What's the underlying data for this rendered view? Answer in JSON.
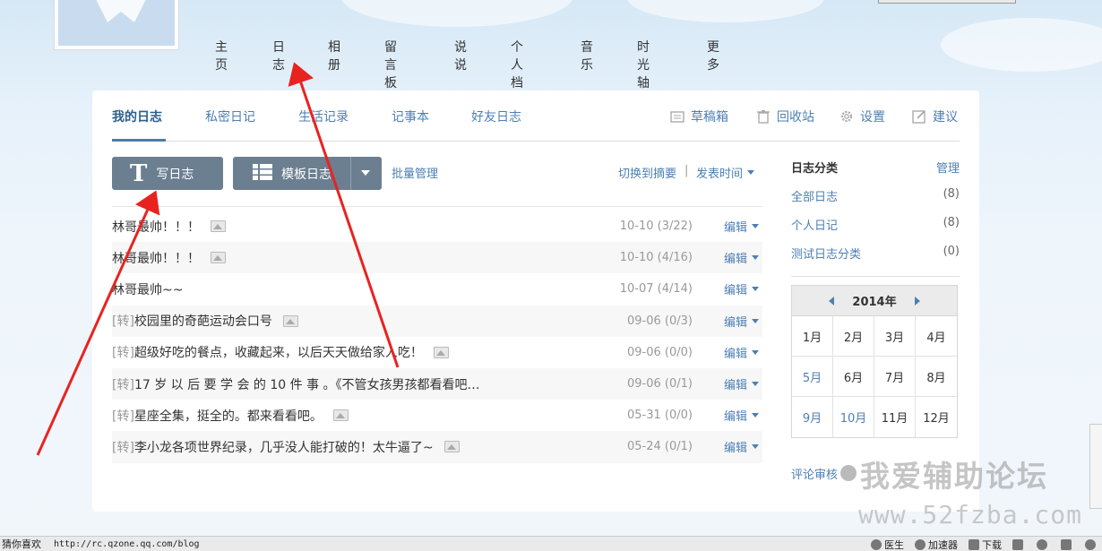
{
  "main_nav": [
    "主页",
    "日志",
    "相册",
    "留言板",
    "说说",
    "个人档",
    "音乐",
    "时光轴",
    "更多"
  ],
  "tabs": [
    "我的日志",
    "私密日记",
    "生活记录",
    "记事本",
    "好友日志"
  ],
  "tools": {
    "drafts": "草稿箱",
    "recycle": "回收站",
    "settings": "设置",
    "suggest": "建议"
  },
  "actions": {
    "write": "写日志",
    "template": "模板日志",
    "batch": "批量管理",
    "switch": "切换到摘要",
    "separator": "|",
    "sort": "发表时间"
  },
  "posts": [
    {
      "prefix": "",
      "title": "林哥最帅！！！",
      "image": true,
      "date": "10-10",
      "stats": "(3/22)",
      "edit": "编辑"
    },
    {
      "prefix": "",
      "title": "林哥最帅！！！",
      "image": true,
      "date": "10-10",
      "stats": "(4/16)",
      "edit": "编辑"
    },
    {
      "prefix": "",
      "title": "林哥最帅~~",
      "image": false,
      "date": "10-07",
      "stats": "(4/14)",
      "edit": "编辑"
    },
    {
      "prefix": "[转]",
      "title": "校园里的奇葩运动会口号",
      "image": true,
      "date": "09-06",
      "stats": "(0/3)",
      "edit": "编辑"
    },
    {
      "prefix": "[转]",
      "title": "超级好吃的餐点，收藏起来，以后天天做给家人吃！",
      "image": true,
      "date": "09-06",
      "stats": "(0/0)",
      "edit": "编辑"
    },
    {
      "prefix": "[转]",
      "title": "17 岁 以 后 要 学 会 的 10 件 事 。《不管女孩男孩都看看吧…",
      "image": false,
      "date": "09-06",
      "stats": "(0/1)",
      "edit": "编辑"
    },
    {
      "prefix": "[转]",
      "title": "星座全集，挺全的。都来看看吧。",
      "image": true,
      "date": "05-31",
      "stats": "(0/0)",
      "edit": "编辑"
    },
    {
      "prefix": "[转]",
      "title": "李小龙各项世界纪录，几乎没人能打破的！太牛逼了~",
      "image": true,
      "date": "05-24",
      "stats": "(0/1)",
      "edit": "编辑"
    }
  ],
  "sidebar": {
    "heading": "日志分类",
    "manage": "管理",
    "categories": [
      {
        "name": "全部日志",
        "count": "(8)"
      },
      {
        "name": "个人日记",
        "count": "(8)"
      },
      {
        "name": "测试日志分类",
        "count": "(0)"
      }
    ]
  },
  "calendar": {
    "year": "2014年",
    "months": [
      {
        "label": "1月",
        "has_posts": false
      },
      {
        "label": "2月",
        "has_posts": false
      },
      {
        "label": "3月",
        "has_posts": false
      },
      {
        "label": "4月",
        "has_posts": false
      },
      {
        "label": "5月",
        "has_posts": true
      },
      {
        "label": "6月",
        "has_posts": false
      },
      {
        "label": "7月",
        "has_posts": false
      },
      {
        "label": "8月",
        "has_posts": false
      },
      {
        "label": "9月",
        "has_posts": true
      },
      {
        "label": "10月",
        "has_posts": true
      },
      {
        "label": "11月",
        "has_posts": false
      },
      {
        "label": "12月",
        "has_posts": false
      }
    ]
  },
  "review": "评论审核",
  "watermark": {
    "title": "我爱辅助论坛",
    "url": "www.52fzba.com"
  },
  "status_bar": {
    "left": "猜你喜欢",
    "url": "http://rc.qzone.qq.com/blog",
    "items": [
      "医生",
      "加速器",
      "下载"
    ]
  },
  "colors": {
    "link": "#4d7fb3",
    "button": "#6b7f91",
    "arrow": "#e8231f"
  }
}
